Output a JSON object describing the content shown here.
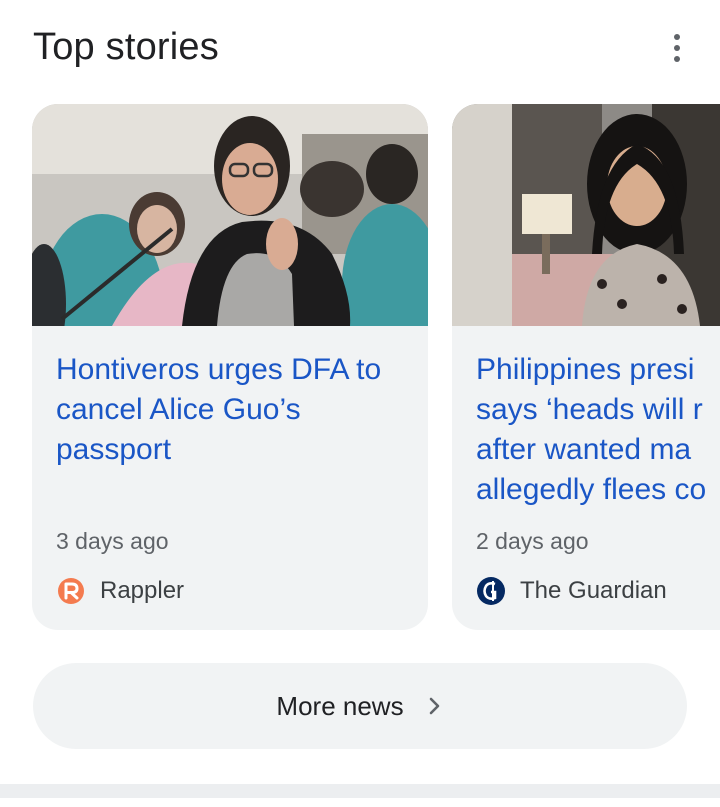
{
  "section": {
    "title": "Top stories",
    "menu_icon": "more-vert-icon"
  },
  "stories": [
    {
      "headline": "Hontiveros urges DFA to cancel Alice Guo’s passport",
      "time": "3 days ago",
      "source": "Rappler",
      "source_icon": "rappler-logo-icon",
      "image": "photo-woman-speaking-at-senate-hearing"
    },
    {
      "headline_lines": [
        "Philippines presi",
        "says ‘heads will r",
        "after wanted ma",
        "allegedly flees co"
      ],
      "time": "2 days ago",
      "source": "The Guardian",
      "source_icon": "guardian-logo-icon",
      "image": "photo-woman-speaking-to-camera"
    }
  ],
  "more_news": {
    "label": "More news",
    "icon": "chevron-right-icon"
  },
  "colors": {
    "link": "#1a56c6",
    "card_bg": "#f1f3f4",
    "text_secondary": "#5f6368"
  }
}
